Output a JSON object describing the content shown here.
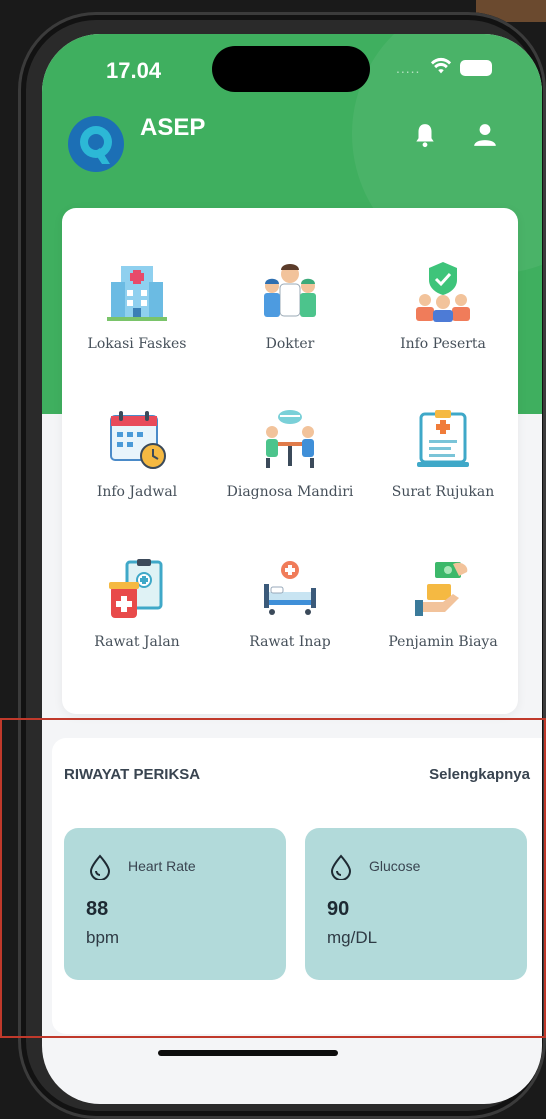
{
  "status_bar": {
    "time": "17.04",
    "signal": "....."
  },
  "app": {
    "name": "ASEP"
  },
  "menu": {
    "items": [
      {
        "label": "Lokasi Faskes",
        "icon": "hospital-building-icon"
      },
      {
        "label": "Dokter",
        "icon": "doctors-icon"
      },
      {
        "label": "Info Peserta",
        "icon": "participants-shield-icon"
      },
      {
        "label": "Info Jadwal",
        "icon": "calendar-clock-icon"
      },
      {
        "label": "Diagnosa Mandiri",
        "icon": "consultation-icon"
      },
      {
        "label": "Surat Rujukan",
        "icon": "referral-clipboard-icon"
      },
      {
        "label": "Rawat Jalan",
        "icon": "outpatient-icon"
      },
      {
        "label": "Rawat Inap",
        "icon": "hospital-bed-icon"
      },
      {
        "label": "Penjamin Biaya",
        "icon": "payment-guarantee-icon"
      }
    ]
  },
  "history": {
    "title": "RIWAYAT PERIKSA",
    "more_link": "Selengkapnya",
    "vitals": [
      {
        "name": "Heart Rate",
        "value": "88",
        "unit": "bpm"
      },
      {
        "name": "Glucose",
        "value": "90",
        "unit": "mg/DL"
      }
    ]
  },
  "colors": {
    "header_green": "#3faf5f",
    "vital_card": "#b2dada",
    "highlight_border": "#c0392b"
  }
}
